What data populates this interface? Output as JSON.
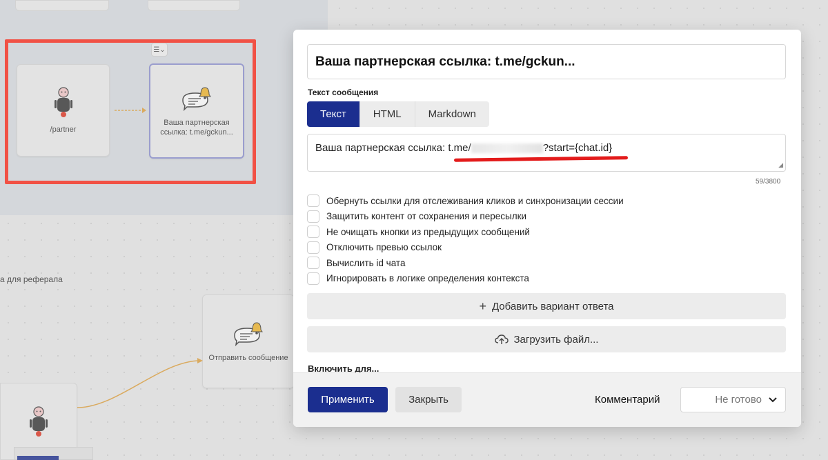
{
  "canvas": {
    "start_node_label": "/partner",
    "message_node_label": "Ваша партнерская ссылка: t.me/gckun...",
    "lower_message_node_label": "Отправить сообщение",
    "side_text": "а для реферала",
    "menu_chip": "☰⌄"
  },
  "modal": {
    "title": "Ваша партнерская ссылка: t.me/gckun...",
    "section_label": "Текст сообщения",
    "tabs": [
      {
        "label": "Текст",
        "active": true
      },
      {
        "label": "HTML",
        "active": false
      },
      {
        "label": "Markdown",
        "active": false
      }
    ],
    "message_prefix": "Ваша партнерская ссылка: ",
    "message_link_start": "t.me/",
    "message_link_end": "?start={chat.id}",
    "counter": "59/3800",
    "options": [
      {
        "label": "Обернуть ссылки для отслеживания кликов и синхронизации сессии",
        "checked": false
      },
      {
        "label": "Защитить контент от сохранения и пересылки",
        "checked": false
      },
      {
        "label": "Не очищать кнопки из предыдущих сообщений",
        "checked": false
      },
      {
        "label": "Отключить превью ссылок",
        "checked": false
      },
      {
        "label": "Вычислить id чата",
        "checked": false
      },
      {
        "label": "Игнорировать в логике определения контекста",
        "checked": false
      }
    ],
    "add_answer_label": "Добавить вариант ответа",
    "upload_file_label": "Загрузить файл...",
    "include_label": "Включить для...",
    "apply_label": "Применить",
    "close_label": "Закрыть",
    "comment_label": "Комментарий",
    "status_value": "Не готово"
  },
  "colors": {
    "primary": "#1b2e8f",
    "highlight_red": "#ff2a1a",
    "connector": "#e0a13c",
    "bell": "#f0b429"
  }
}
